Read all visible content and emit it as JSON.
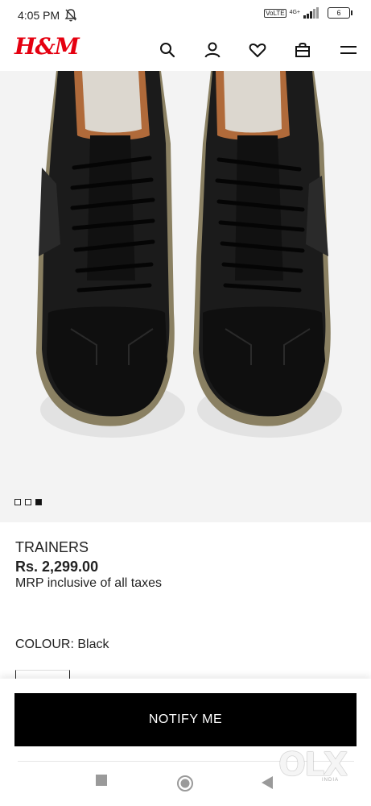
{
  "status_bar": {
    "time": "4:05 PM",
    "volte": "VoLTE",
    "network": "4G+",
    "battery": "6"
  },
  "header": {
    "logo": "H&M",
    "icons": [
      "search-icon",
      "account-icon",
      "favourites-icon",
      "bag-icon",
      "menu-icon"
    ]
  },
  "gallery": {
    "image_count": 3,
    "active_index": 2
  },
  "product": {
    "name": "TRAINERS",
    "price": "Rs. 2,299.00",
    "tax_note": "MRP inclusive of all taxes",
    "colour_label": "COLOUR:",
    "colour_value": "Black"
  },
  "actions": {
    "notify_label": "NOTIFY ME"
  },
  "watermark": {
    "text": "OLX",
    "subtext": "INDIA"
  },
  "colors": {
    "brand_red": "#e50010",
    "button_bg": "#000000",
    "button_text": "#ffffff"
  }
}
